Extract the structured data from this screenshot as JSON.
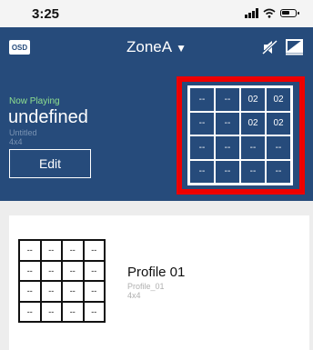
{
  "status_bar": {
    "time": "3:25"
  },
  "header": {
    "osd_label": "OSD",
    "zone_name": "ZoneA",
    "zone_caret": "▼"
  },
  "now_playing": {
    "label": "Now Playing",
    "title": "undefined",
    "subtitle": "Untitled",
    "layout": "4x4",
    "edit_label": "Edit",
    "grid": [
      [
        "--",
        "--",
        "02",
        "02"
      ],
      [
        "--",
        "--",
        "02",
        "02"
      ],
      [
        "--",
        "--",
        "--",
        "--"
      ],
      [
        "--",
        "--",
        "--",
        "--"
      ]
    ]
  },
  "profiles": [
    {
      "title": "Profile 01",
      "subtitle": "Profile_01",
      "layout": "4x4",
      "grid": [
        [
          "--",
          "--",
          "--",
          "--"
        ],
        [
          "--",
          "--",
          "--",
          "--"
        ],
        [
          "--",
          "--",
          "--",
          "--"
        ],
        [
          "--",
          "--",
          "--",
          "--"
        ]
      ]
    }
  ],
  "colors": {
    "header_bg": "#264b7b",
    "now_playing_label": "#8fe08f",
    "highlight": "#e00000"
  },
  "icons": [
    "signal-icon",
    "wifi-icon",
    "battery-icon",
    "mute-icon",
    "screen-off-icon"
  ]
}
